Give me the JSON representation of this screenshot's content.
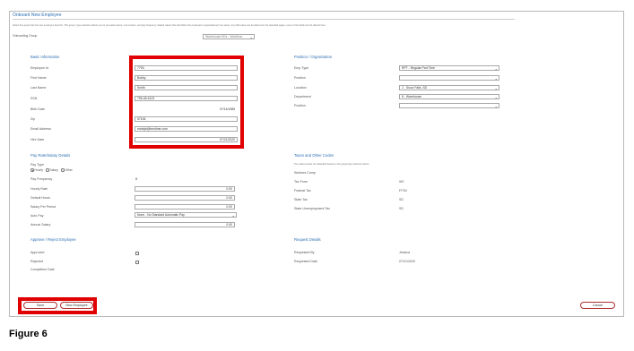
{
  "page": {
    "title": "Onboard New Employee",
    "description": "Select the group that this new employee best fits. This group / type selection allows you to pre-select taxes, cost centers, and pay frequency related values that will define the employee's organizational / tax setup. Any field value can be altered on the standard pages, some of the fields can be altered here.",
    "onboarding_group_label": "Onboarding Group",
    "onboarding_group_value": "Warehouse EEs - Workflow"
  },
  "basic": {
    "title": "Basic Information",
    "employee_id_label": "Employee Id",
    "employee_id": "7793",
    "first_name_label": "First Name",
    "first_name": "Bobby",
    "last_name_label": "Last Name",
    "last_name": "Smith",
    "ssn_label": "SSN",
    "ssn": "795-45-6123",
    "birth_date_label": "Birth Date",
    "birth_date": "07/14/1985",
    "zip_label": "Zip",
    "zip": "57106",
    "email_label": "Email Address",
    "email": "mindyb@tmotime.com",
    "hire_date_label": "Hire Date",
    "hire_date": "07/21/2020"
  },
  "position": {
    "title": "Position / Organization",
    "emp_type_label": "Emp Type",
    "emp_type": "RPT - Regular Part Time",
    "position1_label": "Position",
    "position1": "",
    "location_label": "Location",
    "location": "2 - Sioux Falls, SD",
    "department_label": "Department",
    "department": "8 - Warehouse",
    "position2_label": "Position",
    "position2": ""
  },
  "pay": {
    "title": "Pay Rate/Salary Details",
    "pay_type_label": "Pay Type",
    "opt_hourly": "Hourly",
    "opt_salary": "Salary",
    "opt_other": "Other",
    "pay_frequency_label": "Pay Frequency",
    "pay_frequency": "B",
    "hourly_rate_label": "Hourly Rate",
    "hourly_rate": "0.00",
    "default_hours_label": "Default Hours",
    "default_hours": "0.00",
    "salary_per_period_label": "Salary Per Period",
    "salary_per_period": "0.00",
    "auto_pay_label": "Auto Pay",
    "auto_pay": "None - No Standard Automatic Pay",
    "annual_salary_label": "Annual Salary",
    "annual_salary": "0.00"
  },
  "taxes": {
    "title": "Taxes and Other Codes",
    "note": "The values below are defaulted based on the group/type selection above.",
    "workers_comp_label": "Workers Comp",
    "tax_form_label": "Tax Form",
    "tax_form": "W2",
    "federal_tax_label": "Federal Tax",
    "federal_tax": "FITW",
    "state_tax_label": "State Tax",
    "state_tax": "SD",
    "state_unemp_label": "State Unemployment Tax",
    "state_unemp": "SD"
  },
  "approve": {
    "title": "Approve / Reject Employee",
    "approved_label": "Approved",
    "rejected_label": "Rejected",
    "completion_label": "Completion Date"
  },
  "request": {
    "title": "Request Details",
    "requested_by_label": "Requested By",
    "requested_by": "Jessica",
    "requested_date_label": "Requested Date",
    "requested_date": "07/21/2020"
  },
  "buttons": {
    "save": "Save",
    "new_employee": "New Employee",
    "cancel": "Cancel"
  },
  "caption": "Figure 6",
  "colors": {
    "accent": "#2b6fb3",
    "highlight": "#e00000",
    "button_border": "#b03030"
  }
}
